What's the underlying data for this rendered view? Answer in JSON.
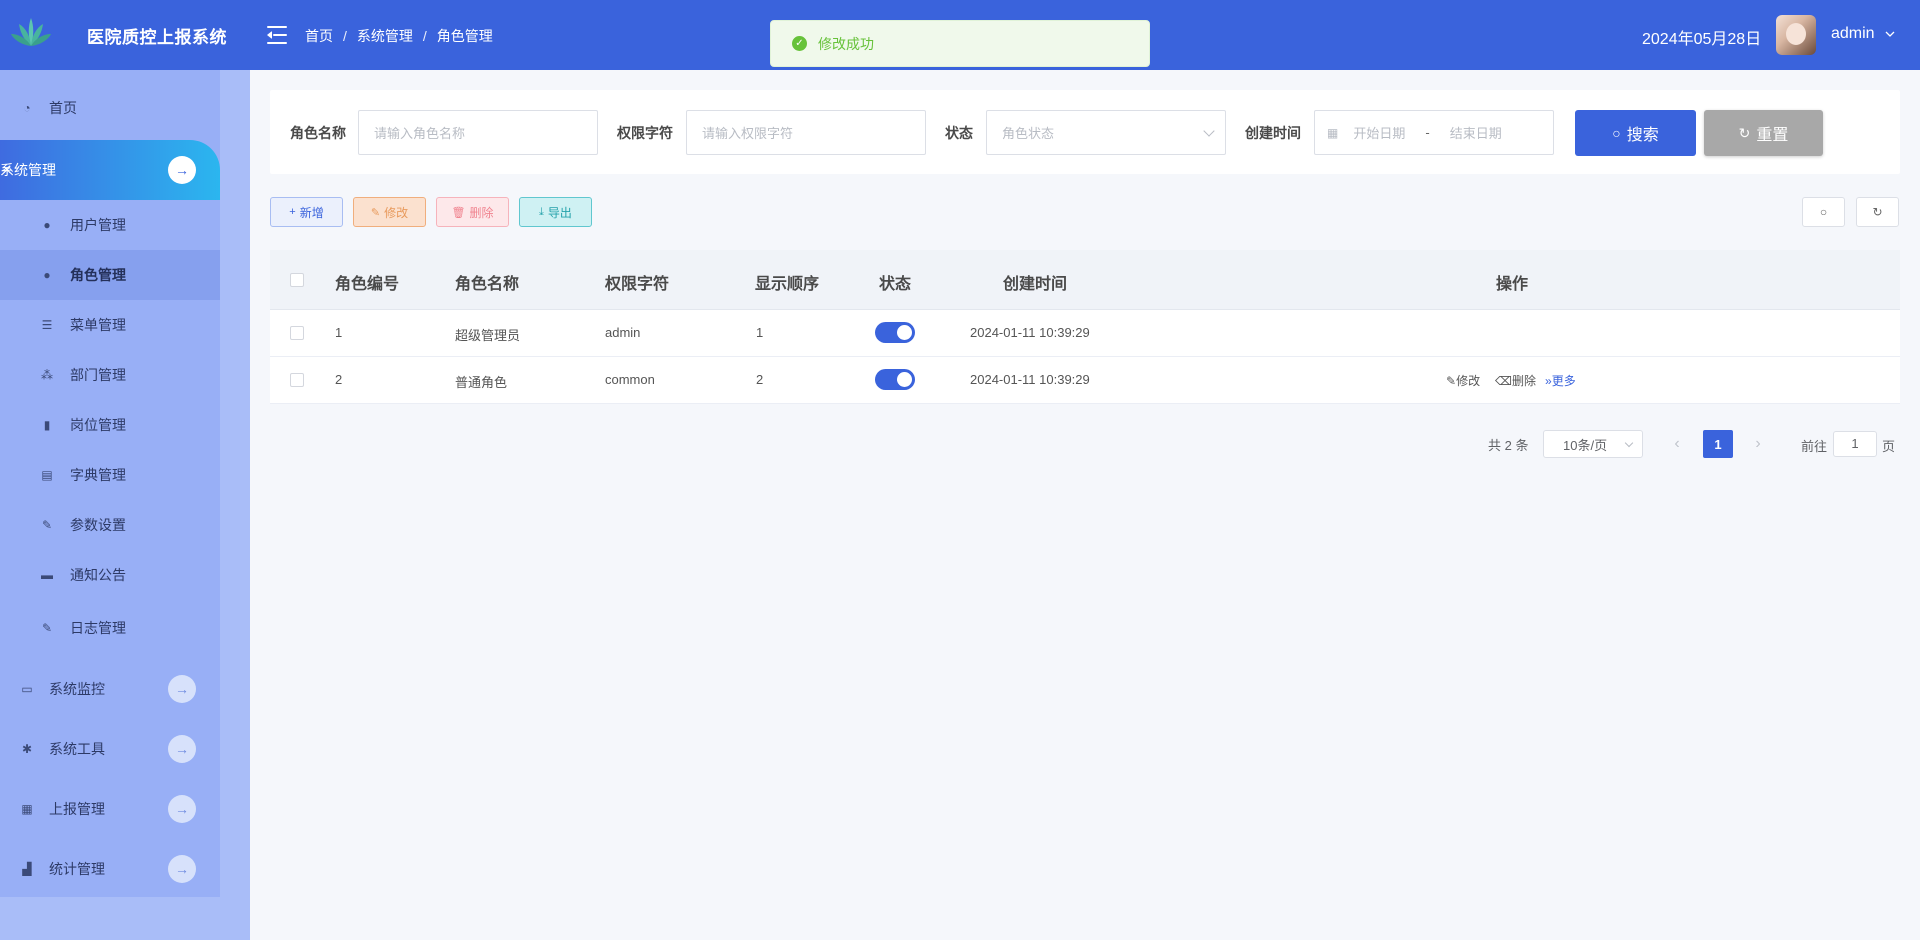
{
  "header": {
    "app_title": "医院质控上报系统",
    "breadcrumb": [
      "首页",
      "系统管理",
      "角色管理"
    ],
    "date": "2024年05月28日",
    "username": "admin",
    "bg_color": "#3a63dc"
  },
  "toast": {
    "message": "修改成功",
    "color": "#67c23a"
  },
  "sidebar": {
    "home": "首页",
    "system": "系统管理",
    "system_children": [
      "用户管理",
      "角色管理",
      "菜单管理",
      "部门管理",
      "岗位管理",
      "字典管理",
      "参数设置",
      "通知公告",
      "日志管理"
    ],
    "monitor": "系统监控",
    "tools": "系统工具",
    "report": "上报管理",
    "stats": "统计管理"
  },
  "search": {
    "role_name_label": "角色名称",
    "role_name_placeholder": "请输入角色名称",
    "perm_label": "权限字符",
    "perm_placeholder": "请输入权限字符",
    "status_label": "状态",
    "status_placeholder": "角色状态",
    "created_label": "创建时间",
    "start_placeholder": "开始日期",
    "range_sep": "-",
    "end_placeholder": "结束日期",
    "search_btn": "搜索",
    "reset_btn": "重置"
  },
  "toolbar": {
    "add": "新增",
    "edit": "修改",
    "delete": "删除",
    "export": "导出"
  },
  "table": {
    "columns": [
      "角色编号",
      "角色名称",
      "权限字符",
      "显示顺序",
      "状态",
      "创建时间",
      "操作"
    ],
    "rows": [
      {
        "id": "1",
        "name": "超级管理员",
        "key": "admin",
        "sort": "1",
        "enabled": true,
        "created": "2024-01-11 10:39:29"
      },
      {
        "id": "2",
        "name": "普通角色",
        "key": "common",
        "sort": "2",
        "enabled": true,
        "created": "2024-01-11 10:39:29"
      }
    ],
    "row_actions": {
      "edit": "修改",
      "delete": "删除",
      "more": "更多"
    }
  },
  "pagination": {
    "total": "共 2 条",
    "page_size": "10条/页",
    "current_page": "1",
    "goto_label": "前往",
    "goto_value": "1",
    "page_suffix": "页"
  }
}
